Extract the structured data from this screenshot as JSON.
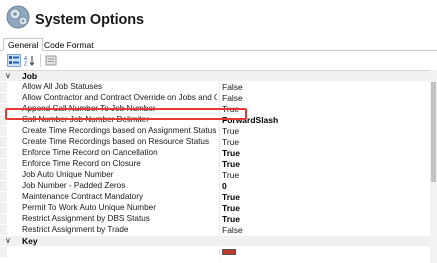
{
  "header": {
    "title": "System Options",
    "icon": "gear-cog-icon"
  },
  "tabs": [
    {
      "label": "General",
      "active": true
    },
    {
      "label": "Code Format",
      "active": false
    }
  ],
  "toolbar": {
    "buttons": [
      "categorized-icon",
      "alphabetical-sort-icon",
      "property-pages-icon"
    ]
  },
  "categories": [
    {
      "label": "Job",
      "expanded": true,
      "properties": [
        {
          "name": "Allow All Job Statuses",
          "value": "False",
          "bold": false
        },
        {
          "name": "Allow Contractor and Contract Override on Jobs and Ord",
          "value": "False",
          "bold": false
        },
        {
          "name": "Append Call Number To Job Number",
          "value": "True",
          "bold": false,
          "highlighted": true
        },
        {
          "name": "Call Number Job Number Delimiter",
          "value": "ForwardSlash",
          "bold": true
        },
        {
          "name": "Create Time Recordings based on Assignment Status",
          "value": "True",
          "bold": false
        },
        {
          "name": "Create Time Recordings based on Resource Status",
          "value": "True",
          "bold": false
        },
        {
          "name": "Enforce Time Record on Cancellation",
          "value": "True",
          "bold": true
        },
        {
          "name": "Enforce Time Record on Closure",
          "value": "True",
          "bold": true
        },
        {
          "name": "Job Auto Unique Number",
          "value": "True",
          "bold": false
        },
        {
          "name": "Job Number - Padded Zeros",
          "value": "0",
          "bold": true
        },
        {
          "name": "Maintenance Contract Mandatory",
          "value": "True",
          "bold": true
        },
        {
          "name": "Permit To Work Auto Unique Number",
          "value": "True",
          "bold": true
        },
        {
          "name": "Restrict Assignment by DBS Status",
          "value": "True",
          "bold": true
        },
        {
          "name": "Restrict Assignment by Trade",
          "value": "False",
          "bold": false
        }
      ]
    },
    {
      "label": "Key",
      "expanded": true,
      "properties": []
    }
  ],
  "colors": {
    "highlight": "#e53935",
    "selection": "#c9dcf2",
    "category_bg": "#f0f0f0",
    "swatch": "#c0392b"
  }
}
